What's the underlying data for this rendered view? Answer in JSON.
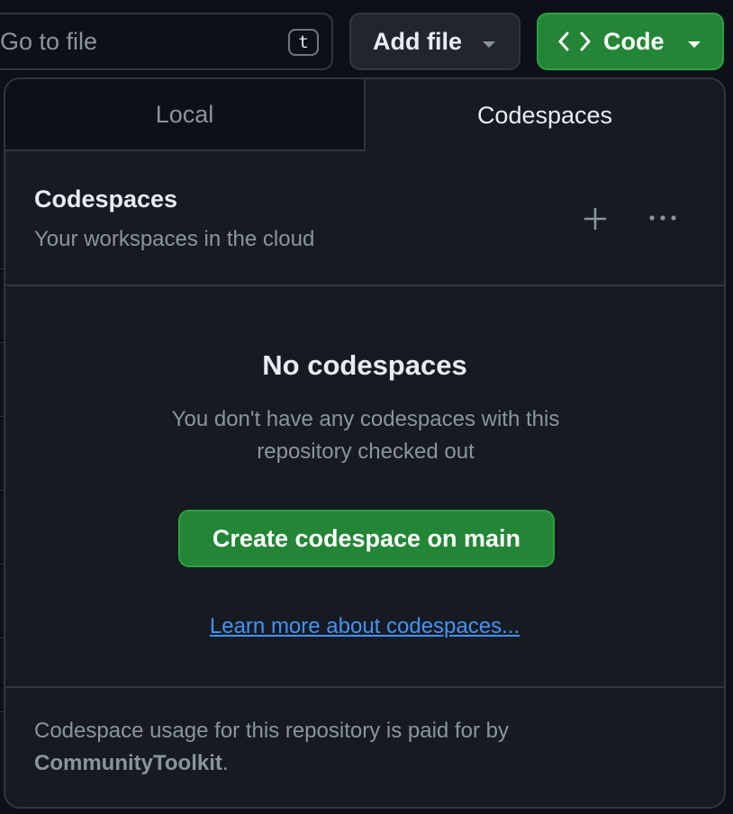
{
  "toolbar": {
    "goto_placeholder": "Go to file",
    "goto_shortcut": "t",
    "add_file_label": "Add file",
    "code_label": "Code"
  },
  "popover": {
    "tabs": [
      {
        "label": "Local",
        "active": false
      },
      {
        "label": "Codespaces",
        "active": true
      }
    ],
    "header": {
      "title": "Codespaces",
      "subtitle": "Your workspaces in the cloud",
      "icons": [
        "plus-icon",
        "kebab-horizontal-icon"
      ]
    },
    "empty_state": {
      "title": "No codespaces",
      "description": "You don't have any codespaces with this repository checked out",
      "create_button": "Create codespace on main",
      "learn_more_link": "Learn more about codespaces..."
    },
    "footer": {
      "text_prefix": "Codespace usage for this repository is paid for by ",
      "org": "CommunityToolkit",
      "text_suffix": "."
    }
  },
  "colors": {
    "background": "#0d1117",
    "panel": "#161b22",
    "border": "#30363d",
    "primary_green": "#238636",
    "muted_text": "#8b949e",
    "link": "#4493f8"
  }
}
